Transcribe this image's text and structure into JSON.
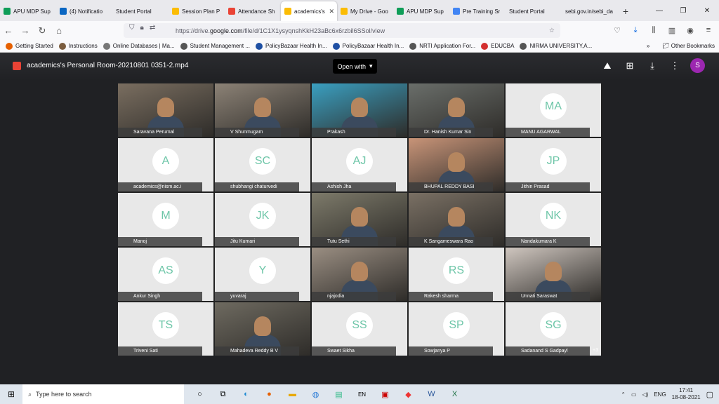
{
  "browser": {
    "tabs": [
      {
        "label": "APU MDP Sup",
        "icon": "sheets-icon",
        "color": "#0f9d58"
      },
      {
        "label": "(4) Notificatio",
        "icon": "linkedin-icon",
        "color": "#0a66c2"
      },
      {
        "label": "Student Portal",
        "icon": "",
        "color": ""
      },
      {
        "label": "Session Plan P",
        "icon": "drive-icon",
        "color": "#fbbc04"
      },
      {
        "label": "Attendance Sh",
        "icon": "gmail-icon",
        "color": "#ea4335"
      },
      {
        "label": "academics's",
        "icon": "drive-icon",
        "color": "#fbbc04"
      },
      {
        "label": "My Drive - Goo",
        "icon": "drive-icon",
        "color": "#fbbc04"
      },
      {
        "label": "APU MDP Sup",
        "icon": "sheets-icon",
        "color": "#0f9d58"
      },
      {
        "label": "Pre Training Sr",
        "icon": "forms-icon",
        "color": "#4285f4"
      },
      {
        "label": "Student Portal",
        "icon": "",
        "color": ""
      },
      {
        "label": "sebi.gov.in/sebi_da",
        "icon": "",
        "color": ""
      }
    ],
    "url_prefix": "https://drive.",
    "url_domain": "google.com",
    "url_rest": "/file/d/1C1X1ysyqnshKkH23aBc6x6rzbil6SSol/view",
    "bookmarks": [
      {
        "label": "Getting Started",
        "color": "#e66000"
      },
      {
        "label": "Instructions",
        "color": "#7b5c3e"
      },
      {
        "label": "Online Databases | Ma...",
        "color": "#777"
      },
      {
        "label": "Student Management ...",
        "color": "#555"
      },
      {
        "label": "PolicyBazaar Health In...",
        "color": "#1e4fa3"
      },
      {
        "label": "PolicyBazaar Health In...",
        "color": "#1e4fa3"
      },
      {
        "label": "NRTI Application For...",
        "color": "#555"
      },
      {
        "label": "EDUCBA",
        "color": "#d32f2f"
      },
      {
        "label": "NIRMA UNIVERSITY,A...",
        "color": "#555"
      }
    ],
    "other_bookmarks": "Other Bookmarks"
  },
  "viewer": {
    "file_title": "academics's Personal Room-20210801 0351-2.mp4",
    "open_with": "Open with",
    "avatar_letter": "S"
  },
  "participants": [
    {
      "name": "Saravana Perumal",
      "initials": "",
      "cam": true
    },
    {
      "name": "V Shunmugam",
      "initials": "",
      "cam": true
    },
    {
      "name": "Prakash",
      "initials": "",
      "cam": true
    },
    {
      "name": "Dr. Hanish Kumar Sin",
      "initials": "",
      "cam": true
    },
    {
      "name": "MANU AGARWAL",
      "initials": "MA",
      "cam": false
    },
    {
      "name": "academics@nism.ac.i",
      "initials": "A",
      "cam": false
    },
    {
      "name": "shubhangi chaturvedi",
      "initials": "SC",
      "cam": false
    },
    {
      "name": "Ashish Jha",
      "initials": "AJ",
      "cam": false
    },
    {
      "name": "BHUPAL REDDY BASI",
      "initials": "",
      "cam": true
    },
    {
      "name": "Jithin Prasad",
      "initials": "JP",
      "cam": false
    },
    {
      "name": "Manoj",
      "initials": "M",
      "cam": false
    },
    {
      "name": "Jitu Kumari",
      "initials": "JK",
      "cam": false
    },
    {
      "name": "Tutu Sethi",
      "initials": "",
      "cam": true
    },
    {
      "name": "K Sangameswara Rao",
      "initials": "",
      "cam": true
    },
    {
      "name": "Nandakumara K",
      "initials": "NK",
      "cam": false
    },
    {
      "name": "Ankur Singh",
      "initials": "AS",
      "cam": false
    },
    {
      "name": "yuvaraj",
      "initials": "Y",
      "cam": false
    },
    {
      "name": "njajodia",
      "initials": "",
      "cam": true
    },
    {
      "name": "Rakesh sharma",
      "initials": "RS",
      "cam": false
    },
    {
      "name": "Unnati Saraswat",
      "initials": "",
      "cam": true
    },
    {
      "name": "Triveni Sati",
      "initials": "TS",
      "cam": false
    },
    {
      "name": "Mahadeva Reddy B V",
      "initials": "",
      "cam": true
    },
    {
      "name": "Swaet Sikha",
      "initials": "SS",
      "cam": false
    },
    {
      "name": "Sowjanya P",
      "initials": "SP",
      "cam": false
    },
    {
      "name": "Sadanand S Gadpayl",
      "initials": "SG",
      "cam": false
    }
  ],
  "more_count": "+3",
  "taskbar": {
    "search_placeholder": "Type here to search",
    "lang": "ENG",
    "time": "17:41",
    "date": "18-08-2021"
  }
}
